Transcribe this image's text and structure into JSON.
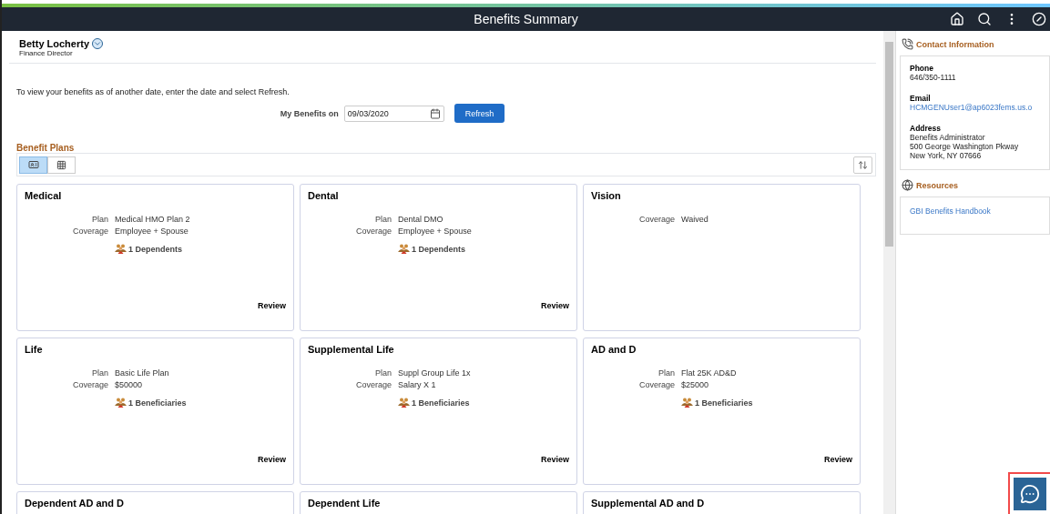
{
  "header": {
    "title": "Benefits Summary"
  },
  "user": {
    "name": "Betty Locherty",
    "role": "Finance Director"
  },
  "instruction": "To view your benefits as of another date, enter the date and select Refresh.",
  "date_filter": {
    "label": "My Benefits on",
    "value": "09/03/2020",
    "button": "Refresh"
  },
  "section_title": "Benefit Plans",
  "view_toggle": [
    {
      "kind": "card",
      "selected": true
    },
    {
      "kind": "grid",
      "selected": false
    }
  ],
  "plans": [
    {
      "title": "Medical",
      "fields": [
        {
          "label": "Plan",
          "value": "Medical HMO Plan 2"
        },
        {
          "label": "Coverage",
          "value": "Employee + Spouse"
        }
      ],
      "people": "1 Dependents",
      "action": "Review"
    },
    {
      "title": "Dental",
      "fields": [
        {
          "label": "Plan",
          "value": "Dental DMO"
        },
        {
          "label": "Coverage",
          "value": "Employee + Spouse"
        }
      ],
      "people": "1 Dependents",
      "action": "Review"
    },
    {
      "title": "Vision",
      "fields": [
        {
          "label": "Coverage",
          "value": "Waived"
        }
      ]
    },
    {
      "title": "Life",
      "fields": [
        {
          "label": "Plan",
          "value": "Basic Life Plan"
        },
        {
          "label": "Coverage",
          "value": "$50000"
        }
      ],
      "people": "1 Beneficiaries",
      "action": "Review"
    },
    {
      "title": "Supplemental Life",
      "fields": [
        {
          "label": "Plan",
          "value": "Suppl Group Life 1x"
        },
        {
          "label": "Coverage",
          "value": "Salary X 1"
        }
      ],
      "people": "1 Beneficiaries",
      "action": "Review"
    },
    {
      "title": "AD and D",
      "fields": [
        {
          "label": "Plan",
          "value": "Flat 25K AD&D"
        },
        {
          "label": "Coverage",
          "value": "$25000"
        }
      ],
      "people": "1 Beneficiaries",
      "action": "Review"
    },
    {
      "title": "Dependent AD and D"
    },
    {
      "title": "Dependent Life"
    },
    {
      "title": "Supplemental AD and D"
    }
  ],
  "contact": {
    "title": "Contact Information",
    "items": [
      {
        "kind": "text",
        "label": "Phone",
        "lines": [
          "646/350-1111"
        ]
      },
      {
        "kind": "link",
        "label": "Email",
        "lines": [
          "HCMGENUser1@ap6023fems.us.o"
        ]
      },
      {
        "kind": "text",
        "label": "Address",
        "lines": [
          "Benefits Administrator",
          "500 George Washington Pkway",
          "New York, NY 07666"
        ]
      }
    ]
  },
  "resources": {
    "title": "Resources",
    "links": [
      "GBI Benefits Handbook"
    ]
  }
}
